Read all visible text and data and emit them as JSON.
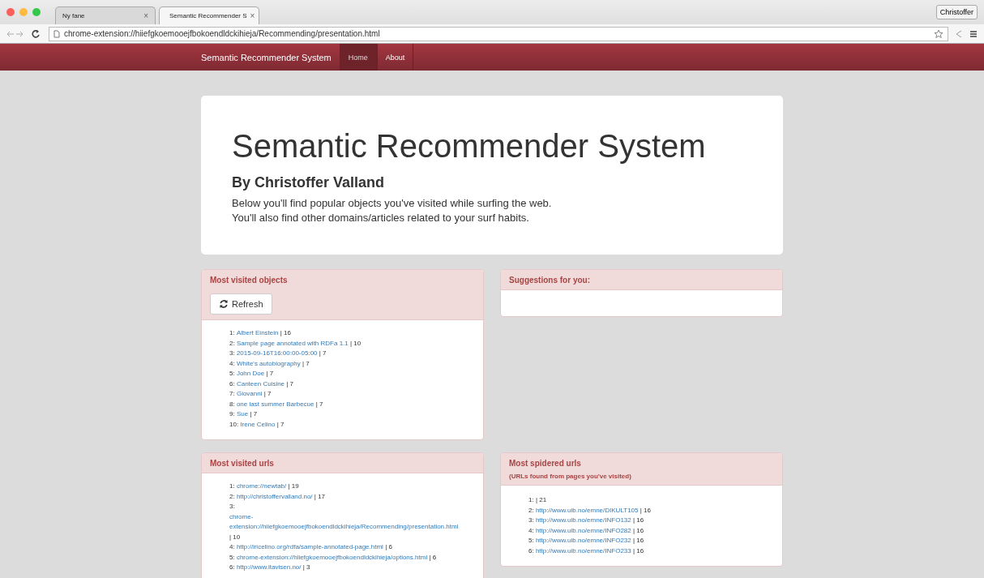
{
  "browser": {
    "tabs": [
      {
        "label": "Ny fane",
        "close": "×",
        "selected": false
      },
      {
        "label": "Semantic Recommender S",
        "close": "×",
        "selected": true
      }
    ],
    "profile": "Christoffer",
    "url": "chrome-extension://hiiefgkoemooejfbokoendldckihieja/Recommending/presentation.html"
  },
  "navbar": {
    "brand": "Semantic Recommender System",
    "links": [
      {
        "label": "Home",
        "selected": true
      },
      {
        "label": "About",
        "selected": false
      }
    ]
  },
  "jumbotron": {
    "title": "Semantic Recommender System",
    "subtitle": "By Christoffer Valland",
    "lines": [
      "Below you'll find popular objects you've visited while surfing the web.",
      "You'll also find other domains/articles related to your surf habits."
    ]
  },
  "panels": [
    {
      "title": "Most visited objects",
      "button": "Refresh",
      "items": [
        {
          "index": "1:",
          "link": "Albert Einstein",
          "count": "| 16"
        },
        {
          "index": "2:",
          "link": "Sample page annotated with RDFa 1.1",
          "count": "| 10"
        },
        {
          "index": "3:",
          "link": "2015-09-16T16:00:00-05:00",
          "count": "| 7"
        },
        {
          "index": "4:",
          "link": "White's autobiography",
          "count": "| 7"
        },
        {
          "index": "5:",
          "link": "John Doe",
          "count": "| 7"
        },
        {
          "index": "6:",
          "link": "Canteen Cuisine",
          "count": "| 7"
        },
        {
          "index": "7:",
          "link": "Giovanni",
          "count": "| 7"
        },
        {
          "index": "8:",
          "link": "one last summer Barbecue",
          "count": "| 7"
        },
        {
          "index": "9:",
          "link": "Sue",
          "count": "| 7"
        },
        {
          "index": "10:",
          "link": "Irene Celino",
          "count": "| 7"
        }
      ]
    },
    {
      "title": "Suggestions for you:"
    },
    {
      "title": "Most visited urls",
      "items": [
        {
          "index": "1:",
          "link": "chrome://newtab/",
          "count": "| 19"
        },
        {
          "index": "2:",
          "link": "http://christoffervalland.no/",
          "count": "| 17"
        },
        {
          "index": "3:",
          "link": "chrome-extension://hiiefgkoemooejfbokoendldckihieja/Recommending/presentation.html",
          "count": "| 10"
        },
        {
          "index": "4:",
          "link": "http://iricelino.org/rdfa/sample-annotated-page.html",
          "count": "| 6"
        },
        {
          "index": "5:",
          "link": "chrome-extension://hiiefgkoemooejfbokoendldckihieja/options.html",
          "count": "| 6"
        },
        {
          "index": "6:",
          "link": "http://www.itavisen.no/",
          "count": "| 3"
        }
      ]
    },
    {
      "title": "Most spidered urls",
      "subtitle": "(URLs found from pages you've visited)",
      "items": [
        {
          "index": "1:",
          "count": "| 21"
        },
        {
          "index": "2:",
          "link": "http://www.uib.no/emne/DIKULT105",
          "count": "| 16"
        },
        {
          "index": "3:",
          "link": "http://www.uib.no/emne/INFO132",
          "count": "| 16"
        },
        {
          "index": "4:",
          "link": "http://www.uib.no/emne/INFO282",
          "count": "| 16"
        },
        {
          "index": "5:",
          "link": "http://www.uib.no/emne/INFO232",
          "count": "| 16"
        },
        {
          "index": "6:",
          "link": "http://www.uib.no/emne/INFO233",
          "count": "| 16"
        }
      ]
    }
  ]
}
